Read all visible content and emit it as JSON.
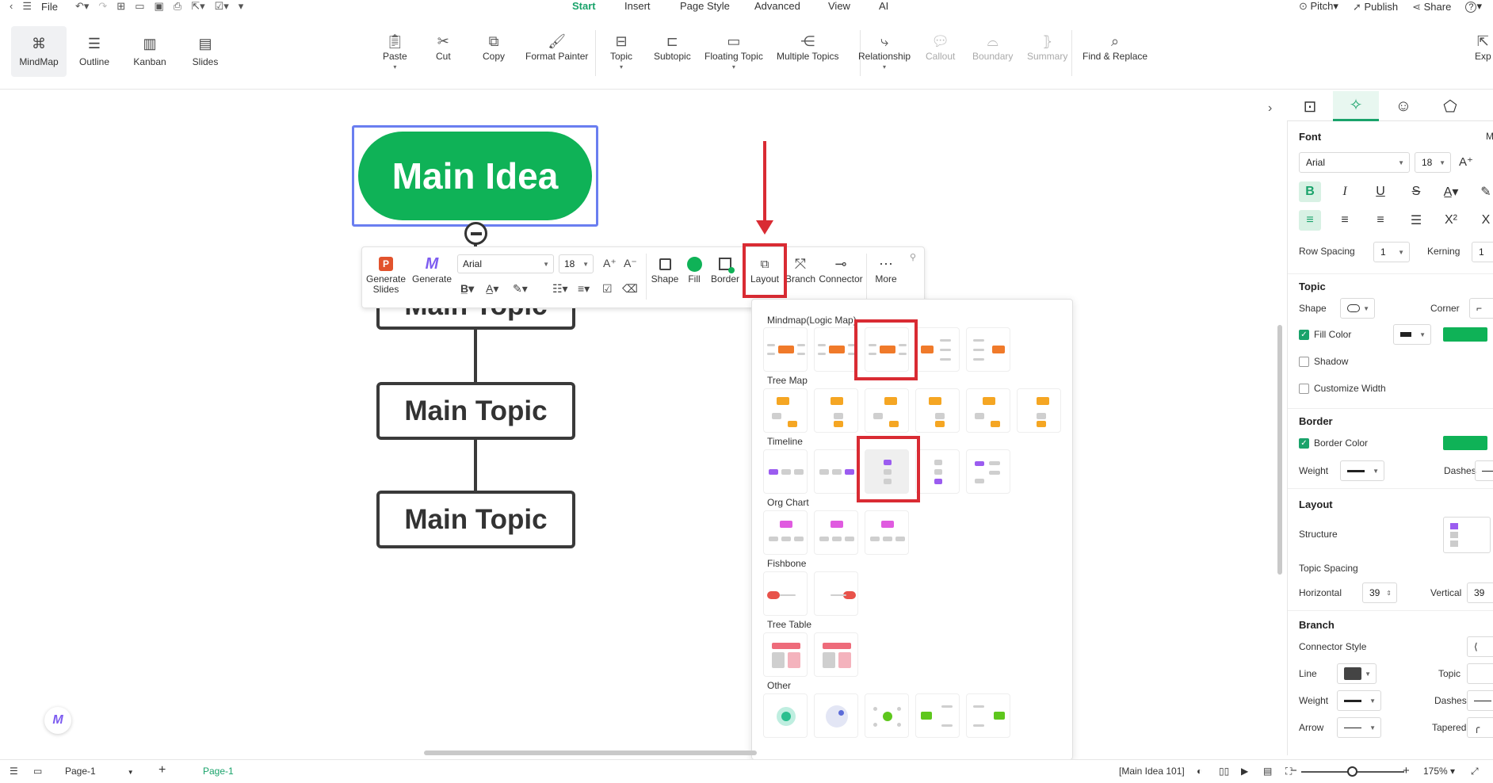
{
  "menubar": {
    "file_label": "File",
    "tabs": [
      "Start",
      "Insert",
      "Page Style",
      "Advanced",
      "View",
      "AI"
    ],
    "active_tab": "Start",
    "pitch_label": "Pitch",
    "publish_label": "Publish",
    "share_label": "Share",
    "help_label": "?"
  },
  "views": [
    {
      "label": "MindMap",
      "icon": "mindmap-icon",
      "active": true
    },
    {
      "label": "Outline",
      "icon": "outline-icon",
      "active": false
    },
    {
      "label": "Kanban",
      "icon": "kanban-icon",
      "active": false
    },
    {
      "label": "Slides",
      "icon": "slides-icon",
      "active": false
    }
  ],
  "ribbon": {
    "paste": "Paste",
    "cut": "Cut",
    "copy": "Copy",
    "format_painter": "Format Painter",
    "topic": "Topic",
    "subtopic": "Subtopic",
    "floating_topic": "Floating Topic",
    "multiple_topics": "Multiple Topics",
    "relationship": "Relationship",
    "callout": "Callout",
    "boundary": "Boundary",
    "summary": "Summary",
    "find_replace": "Find & Replace",
    "export": "Exp"
  },
  "canvas": {
    "main_idea": "Main Idea",
    "topics": [
      "Main Topic",
      "Main Topic",
      "Main Topic"
    ]
  },
  "float_toolbar": {
    "generate_slides": "Generate Slides",
    "generate": "Generate",
    "font": "Arial",
    "size": "18",
    "shape": "Shape",
    "fill": "Fill",
    "border": "Border",
    "layout": "Layout",
    "branch": "Branch",
    "connector": "Connector",
    "more": "More"
  },
  "layout_panel": {
    "sections": [
      "Mindmap(Logic Map)",
      "Tree Map",
      "Timeline",
      "Org Chart",
      "Fishbone",
      "Tree Table",
      "Other"
    ],
    "item_counts": [
      5,
      6,
      5,
      3,
      2,
      2,
      5
    ],
    "accent_colors": {
      "mindmap": "#f07a2a",
      "tree": "#f5a623",
      "timeline": "#9b5cf0",
      "org": "#e05be0",
      "fishbone": "#e8524a",
      "table": "#ee6b7a",
      "other": "#5ec71d"
    }
  },
  "right_panel": {
    "font_header": "Font",
    "font_name": "Arial",
    "font_size": "18",
    "row_spacing_label": "Row Spacing",
    "row_spacing": "1",
    "kerning_label": "Kerning",
    "kerning": "1",
    "topic_header": "Topic",
    "shape_label": "Shape",
    "corner_label": "Corner",
    "fill_color_label": "Fill Color",
    "shadow_label": "Shadow",
    "customize_width_label": "Customize Width",
    "border_header": "Border",
    "border_color_label": "Border Color",
    "weight_label": "Weight",
    "dashes_label": "Dashes",
    "layout_header": "Layout",
    "structure_label": "Structure",
    "topic_spacing_label": "Topic Spacing",
    "horizontal_label": "Horizontal",
    "horizontal_value": "39",
    "vertical_label": "Vertical",
    "vertical_value": "39",
    "branch_header": "Branch",
    "connector_style_label": "Connector Style",
    "line_label": "Line",
    "topic_label": "Topic",
    "branch_weight_label": "Weight",
    "branch_dashes_label": "Dashes",
    "arrow_label": "Arrow",
    "tapered_label": "Tapered",
    "accent": "#0fb257"
  },
  "statusbar": {
    "page_select": "Page-1",
    "page_tab": "Page-1",
    "selection_info": "[Main Idea 101]",
    "zoom": "175%"
  }
}
